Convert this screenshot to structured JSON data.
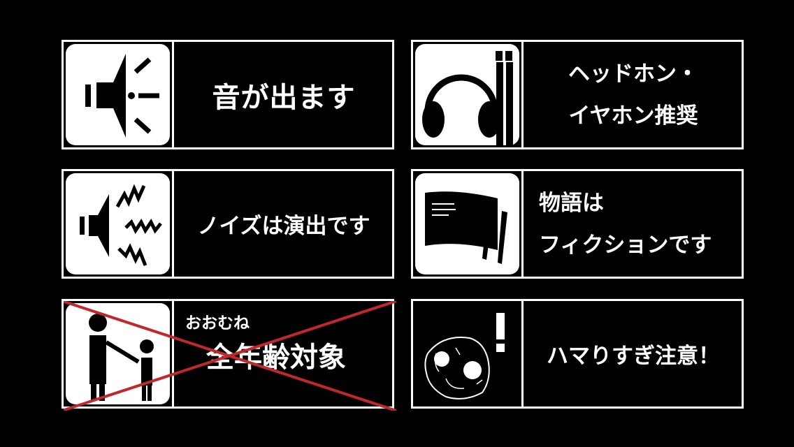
{
  "cards": {
    "sound": {
      "text": "音が出ます",
      "icon": "speaker-icon"
    },
    "headphone": {
      "line1": "ヘッドホン・",
      "line2": "イヤホン推奨",
      "icon": "headphones-icon"
    },
    "noise": {
      "text": "ノイズは演出です",
      "icon": "noise-speaker-icon"
    },
    "fiction": {
      "line1": "物語は",
      "line2": "フィクションです",
      "icon": "book-icon"
    },
    "ages": {
      "small": "おおむね",
      "big": "全年齢対象",
      "icon": "parent-child-icon"
    },
    "addictive": {
      "text": "ハマりすぎ注意！",
      "icon": "scribble-face-icon"
    }
  },
  "colors": {
    "background": "#000000",
    "foreground": "#ffffff",
    "cross": "#c0282a"
  }
}
